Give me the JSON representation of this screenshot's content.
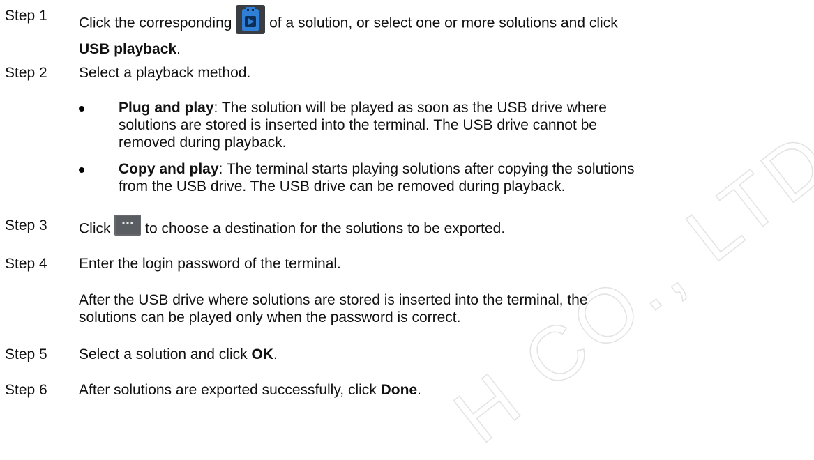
{
  "steps": [
    {
      "label": "Step 1",
      "parts": {
        "a": "Click the corresponding ",
        "b": " of a solution, or select one or more solutions and click",
        "c": "USB playback",
        "d": "."
      }
    },
    {
      "label": "Step 2",
      "text": "Select a playback method."
    },
    {
      "label": "Step 3",
      "parts": {
        "a": "Click ",
        "b": " to choose a destination for the solutions to be exported."
      }
    },
    {
      "label": "Step 4",
      "text": "Enter the login password of the terminal."
    },
    {
      "label": "Step 5",
      "parts": {
        "a": "Select a solution and click ",
        "b": "OK",
        "c": "."
      }
    },
    {
      "label": "Step 6",
      "parts": {
        "a": "After solutions are exported successfully, click ",
        "b": "Done",
        "c": "."
      }
    }
  ],
  "bullets": [
    {
      "term": "Plug and play",
      "line1": ": The solution will be played as soon as the USB drive where",
      "line2": "solutions are stored is inserted into the terminal. The USB drive cannot be",
      "line3": "removed during playback."
    },
    {
      "term": "Copy and play",
      "line1": ": The terminal starts playing solutions after copying the solutions",
      "line2": "from the USB drive. The USB drive can be removed during playback."
    }
  ],
  "step4_note": {
    "line1": "After the USB drive where solutions are stored is inserted into the terminal, the",
    "line2": "solutions can be played only when the password is correct."
  },
  "icons": {
    "usb_play": "usb-play-icon",
    "ellipsis": "ellipsis-button-icon"
  },
  "colors": {
    "text": "#111111",
    "usb_icon": "#2f7fd6",
    "icon_bg": "#3a3d42",
    "ellipsis_bg": "#5a5d61",
    "watermark": "#e6e6e6"
  },
  "watermark_text": "H CO., LTD"
}
